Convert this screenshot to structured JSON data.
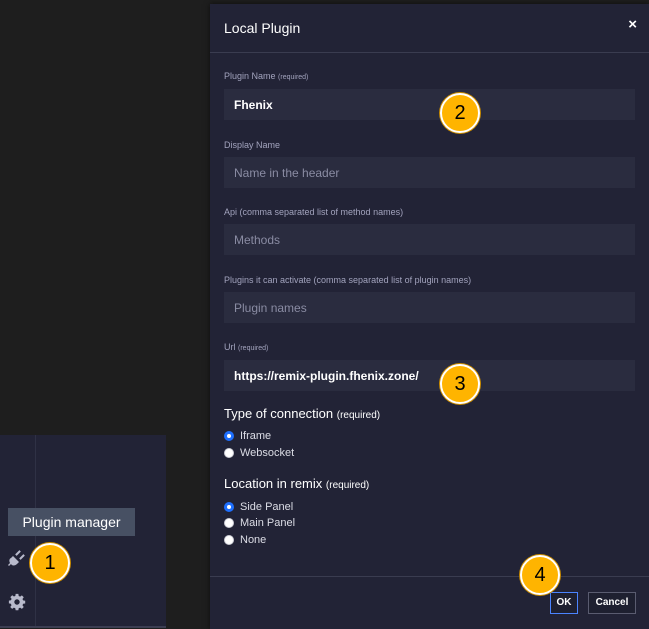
{
  "modal": {
    "title": "Local Plugin",
    "close": "×",
    "plugin_name": {
      "label": "Plugin Name",
      "req": "(required)",
      "value": "Fhenix"
    },
    "display_name": {
      "label": "Display Name",
      "placeholder": "Name in the header"
    },
    "api": {
      "label": "Api  (comma separated list of method names)",
      "placeholder": "Methods"
    },
    "activate": {
      "label": "Plugins it can activate  (comma separated list of plugin names)",
      "placeholder": "Plugin names"
    },
    "url": {
      "label": "Url",
      "req": "(required)",
      "value": "https://remix-plugin.fhenix.zone/"
    },
    "connection": {
      "title": "Type of connection",
      "req": "(required)",
      "options": [
        {
          "label": "Iframe",
          "checked": true
        },
        {
          "label": "Websocket",
          "checked": false
        }
      ]
    },
    "location": {
      "title": "Location in remix",
      "req": "(required)",
      "options": [
        {
          "label": "Side Panel",
          "checked": true
        },
        {
          "label": "Main Panel",
          "checked": false
        },
        {
          "label": "None",
          "checked": false
        }
      ]
    },
    "ok_label": "OK",
    "cancel_label": "Cancel"
  },
  "tooltip": "Plugin manager",
  "icons": [
    "plug-icon",
    "gear-icon"
  ],
  "callouts": [
    "1",
    "2",
    "3",
    "4"
  ],
  "colors": {
    "callout": "#ffb400",
    "accent": "#4b84ff",
    "panel": "#222336"
  }
}
